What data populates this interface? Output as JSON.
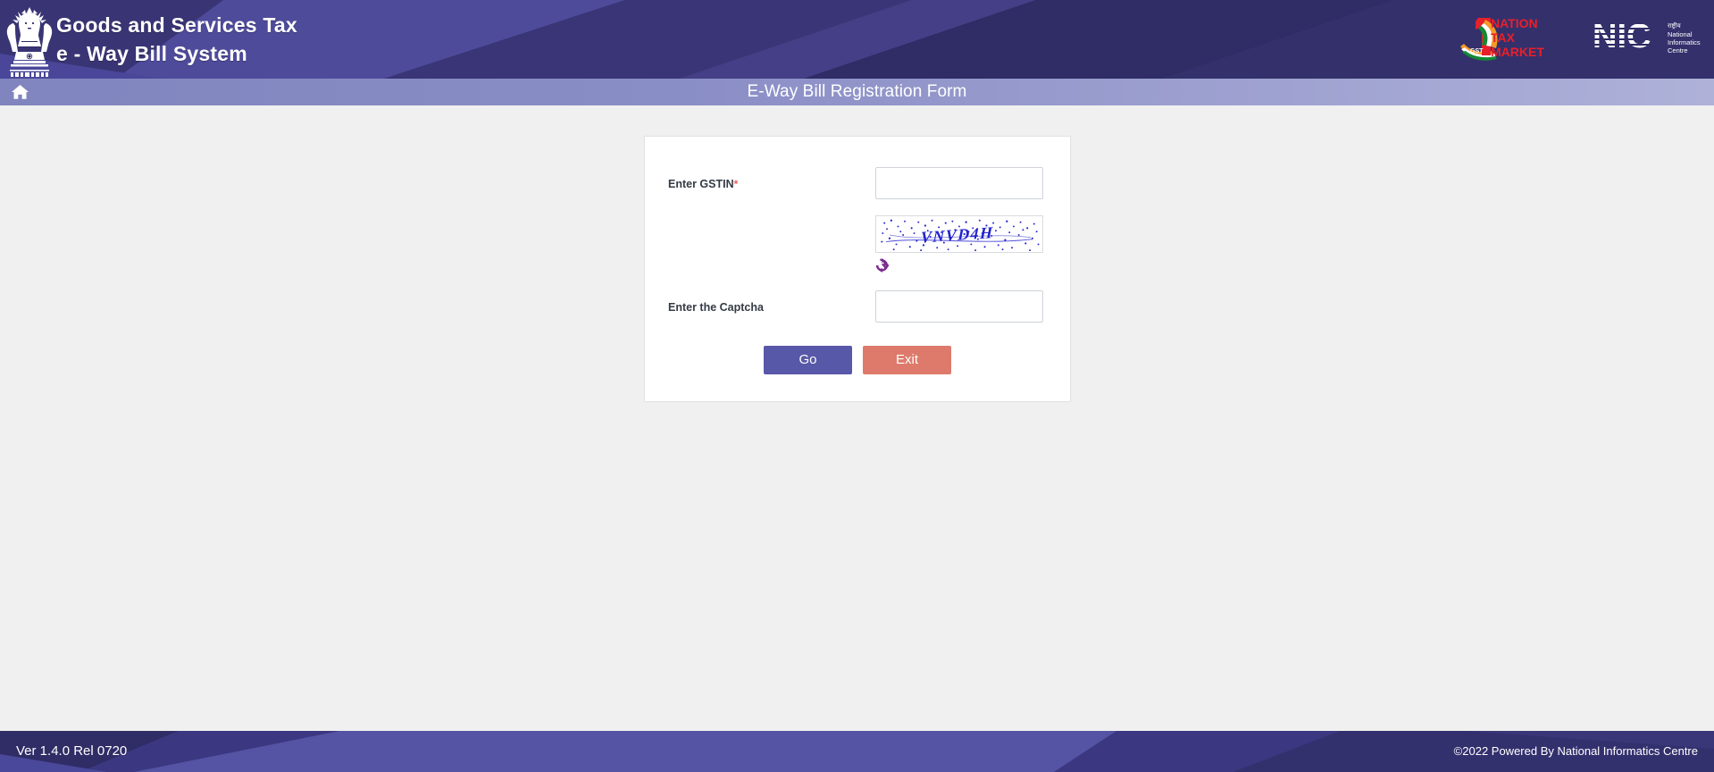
{
  "header": {
    "emblem_alt": "national-emblem-of-india",
    "brand_line1": "Goods and Services Tax",
    "brand_line2": "e - Way Bill System",
    "gst_logo": {
      "one": "1",
      "line1": "NATION",
      "line2": "TAX",
      "line3": "MARKET",
      "gst_text": "GST"
    },
    "nic_logo": {
      "mark": "NIC",
      "hindi": "राष्ट्रीय",
      "line1": "National",
      "line2": "Informatics",
      "line3": "Centre"
    },
    "colors": {
      "bg_dark": "#2d2a63",
      "bg_mid": "#383470",
      "bg_light": "#4e4b9b"
    }
  },
  "navbar": {
    "home_icon": "home-icon",
    "title": "E-Way Bill Registration Form"
  },
  "form": {
    "gstin": {
      "label": "Enter GSTIN",
      "required_marker": "*",
      "value": "",
      "placeholder": ""
    },
    "captcha": {
      "image_text": "VNVD4H",
      "refresh_icon": "refresh-icon",
      "label": "Enter the Captcha",
      "value": "",
      "placeholder": ""
    },
    "buttons": {
      "go": "Go",
      "exit": "Exit"
    },
    "colors": {
      "go_bg": "#5758a8",
      "exit_bg": "#dd7a6b",
      "required_star": "#ea5a54",
      "captcha_ink": "#2222cc",
      "refresh": "#7b2a8c"
    }
  },
  "footer": {
    "version": "Ver 1.4.0 Rel 0720",
    "copyright": "©2022 Powered By National Informatics Centre",
    "colors": {
      "bg_dark": "#2d2a63",
      "bg_light": "#5453a4"
    }
  }
}
